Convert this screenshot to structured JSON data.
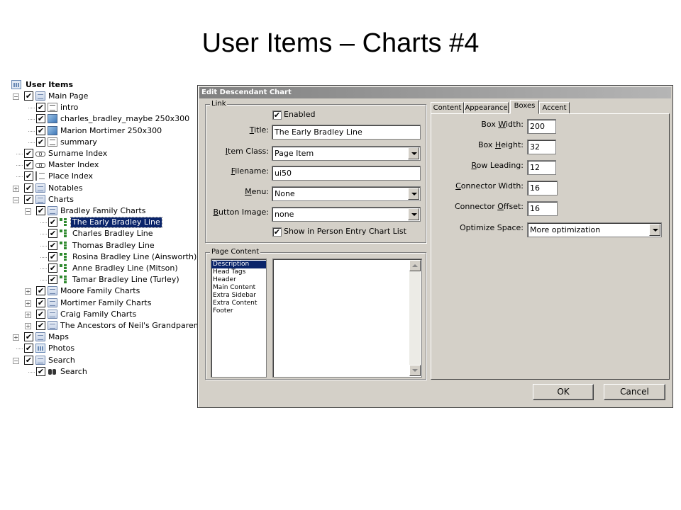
{
  "slide": {
    "title": "User Items – Charts #4"
  },
  "tree": {
    "root": "User Items",
    "items": [
      {
        "label": "Main Page",
        "icon": "page-icon",
        "checked": true,
        "expander": "−"
      },
      {
        "label": "intro",
        "icon": "text-icon",
        "checked": true
      },
      {
        "label": "charles_bradley_maybe 250x300",
        "icon": "image-icon",
        "checked": true
      },
      {
        "label": "Marion Mortimer 250x300",
        "icon": "image-icon",
        "checked": true
      },
      {
        "label": "summary",
        "icon": "text-icon",
        "checked": true
      },
      {
        "label": "Surname Index",
        "icon": "link-icon",
        "checked": true
      },
      {
        "label": "Master Index",
        "icon": "link-icon",
        "checked": true
      },
      {
        "label": "Place Index",
        "icon": "place-icon",
        "checked": true
      },
      {
        "label": "Notables",
        "icon": "page-icon",
        "checked": true,
        "expander": "+"
      },
      {
        "label": "Charts",
        "icon": "page-icon",
        "checked": true,
        "expander": "−"
      },
      {
        "label": "Bradley Family Charts",
        "icon": "page-icon",
        "checked": true,
        "expander": "−"
      },
      {
        "label": "The Early Bradley Line",
        "icon": "chart-icon",
        "checked": true,
        "selected": true
      },
      {
        "label": "Charles Bradley Line",
        "icon": "chart-icon",
        "checked": true
      },
      {
        "label": "Thomas Bradley Line",
        "icon": "chart-icon",
        "checked": true
      },
      {
        "label": "Rosina Bradley Line (Ainsworth)",
        "icon": "chart-icon",
        "checked": true
      },
      {
        "label": "Anne Bradley Line (Mitson)",
        "icon": "chart-icon",
        "checked": true
      },
      {
        "label": "Tamar Bradley Line (Turley)",
        "icon": "chart-icon",
        "checked": true
      },
      {
        "label": "Moore Family Charts",
        "icon": "page-icon",
        "checked": true,
        "expander": "+"
      },
      {
        "label": "Mortimer Family Charts",
        "icon": "page-icon",
        "checked": true,
        "expander": "+"
      },
      {
        "label": "Craig Family Charts",
        "icon": "page-icon",
        "checked": true,
        "expander": "+"
      },
      {
        "label": "The Ancestors of Neil's Grandparents",
        "icon": "page-icon",
        "checked": true,
        "expander": "+"
      },
      {
        "label": "Maps",
        "icon": "page-icon",
        "checked": true,
        "expander": "+"
      },
      {
        "label": "Photos",
        "icon": "photo-icon",
        "checked": true
      },
      {
        "label": "Search",
        "icon": "page-icon",
        "checked": true,
        "expander": "−"
      },
      {
        "label": "Search",
        "icon": "binoculars-icon",
        "checked": true
      }
    ]
  },
  "dialog": {
    "title": "Edit Descendant Chart",
    "link_group": {
      "caption": "Link",
      "enabled_label": "Enabled",
      "enabled_checked": true,
      "title_label_u": "T",
      "title_label_rest": "itle:",
      "title_value": "The Early Bradley Line",
      "item_class_label_u": "I",
      "item_class_label_rest": "tem Class:",
      "item_class_value": "Page Item",
      "filename_label_u": "F",
      "filename_label_rest": "ilename:",
      "filename_value": "ui50",
      "menu_label_u": "M",
      "menu_label_rest": "enu:",
      "menu_value": "None",
      "button_image_label_u": "B",
      "button_image_label_rest": "utton Image:",
      "button_image_value": "none",
      "show_in_list_label": "Show in Person Entry Chart List",
      "show_in_list_checked": true
    },
    "page_content": {
      "caption": "Page Content",
      "items": [
        "Description",
        "Head Tags",
        "Header",
        "Main Content",
        "Extra Sidebar",
        "Extra Content",
        "Footer"
      ],
      "selected": "Description"
    },
    "tabs": [
      "Content",
      "Appearance",
      "Boxes",
      "Accent"
    ],
    "active_tab": "Boxes",
    "boxes": {
      "box_width_label_a": "Box ",
      "box_width_label_u": "W",
      "box_width_label_b": "idth:",
      "box_width": "200",
      "box_height_label_a": "Box ",
      "box_height_label_u": "H",
      "box_height_label_b": "eight:",
      "box_height": "32",
      "row_leading_label_a": "",
      "row_leading_label_u": "R",
      "row_leading_label_b": "ow Leading:",
      "row_leading": "12",
      "connector_width_label_a": "",
      "connector_width_label_u": "C",
      "connector_width_label_b": "onnector Width:",
      "connector_width": "16",
      "connector_offset_label_a": "Connector ",
      "connector_offset_label_u": "O",
      "connector_offset_label_b": "ffset:",
      "connector_offset": "16",
      "optimize_label": "Optimize Space:",
      "optimize_value": "More optimization"
    },
    "ok_label": "OK",
    "cancel_label": "Cancel"
  }
}
